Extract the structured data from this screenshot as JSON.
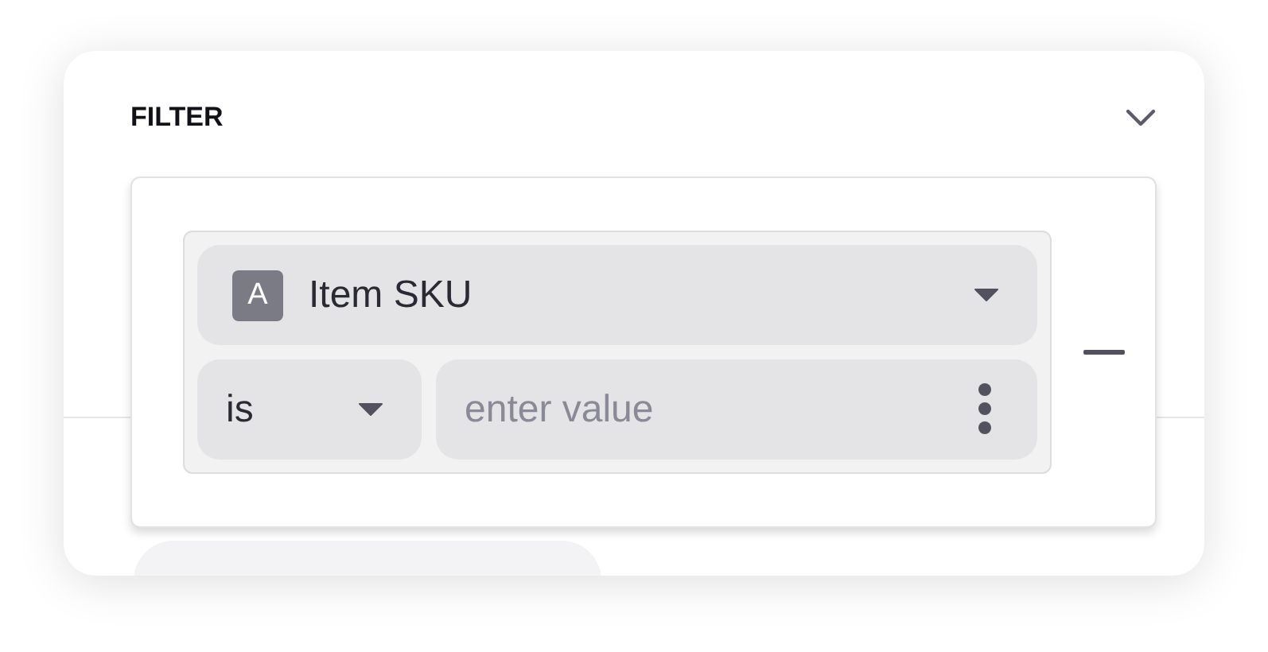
{
  "panel": {
    "title": "FILTER"
  },
  "condition": {
    "field": {
      "type_badge": "A",
      "label": "Item SKU"
    },
    "operator": "is",
    "value": {
      "placeholder": "enter value"
    }
  }
}
